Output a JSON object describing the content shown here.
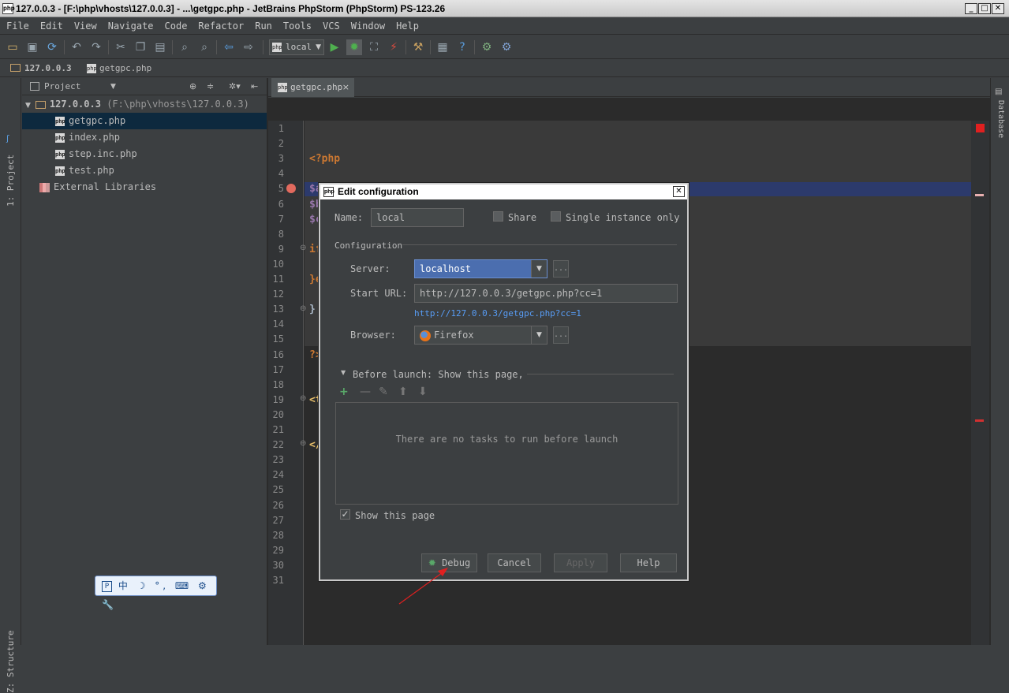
{
  "window": {
    "title": "127.0.0.3 - [F:\\php\\vhosts\\127.0.0.3] - ...\\getgpc.php - JetBrains PhpStorm (PhpStorm) PS-123.26",
    "app_icon_label": "php",
    "minimize": "_",
    "maximize": "□",
    "close": "✕"
  },
  "menu": [
    "File",
    "Edit",
    "View",
    "Navigate",
    "Code",
    "Refactor",
    "Run",
    "Tools",
    "VCS",
    "Window",
    "Help"
  ],
  "toolbar": {
    "run_config": "local",
    "icons": [
      "open-icon",
      "save-icon",
      "sync-icon",
      "undo-icon",
      "redo-icon",
      "cut-icon",
      "copy-icon",
      "paste-icon",
      "find-icon",
      "replace-icon",
      "back-icon",
      "forward-icon",
      "run-icon",
      "debug-icon",
      "coverage-icon",
      "stop-icon",
      "settings-icon",
      "structure-icon",
      "help-icon",
      "plugin-icon",
      "plugin2-icon"
    ]
  },
  "breadcrumb": {
    "project": "127.0.0.3",
    "file": "getgpc.php"
  },
  "left_strip": {
    "project_tab": "1: Project",
    "structure_tab": "Z: Structure"
  },
  "project_panel": {
    "title": "Project",
    "root_name": "127.0.0.3",
    "root_path": "(F:\\php\\vhosts\\127.0.0.3)",
    "files": [
      "getgpc.php",
      "index.php",
      "step.inc.php",
      "test.php"
    ],
    "external": "External Libraries"
  },
  "ime_bar": {
    "text": "中 ☽ °, ⌨ ⚙ 🔧"
  },
  "editor": {
    "tab": "getgpc.php",
    "tab_close": "×",
    "line_count": 31,
    "visible_code": [
      {
        "line": 3,
        "text": "<?php",
        "color": "#cc7832"
      },
      {
        "line": 5,
        "text": "$a",
        "color": "#9876aa"
      },
      {
        "line": 6,
        "text": "$b",
        "color": "#9876aa"
      },
      {
        "line": 7,
        "text": "$c",
        "color": "#9876aa"
      },
      {
        "line": 9,
        "text": "if",
        "color": "#cc7832"
      },
      {
        "line": 11,
        "text": "}e",
        "color": "#cc7832"
      },
      {
        "line": 13,
        "text": "}",
        "color": "#a9b7c6"
      },
      {
        "line": 16,
        "text": "?>",
        "color": "#cc7832"
      },
      {
        "line": 19,
        "text": "<t",
        "color": "#e8bf6a"
      },
      {
        "line": 22,
        "text": "</",
        "color": "#e8bf6a"
      }
    ]
  },
  "right_strip": {
    "database_tab": "Database"
  },
  "dialog": {
    "title": "Edit configuration",
    "name_label": "Name:",
    "name_value": "local",
    "share_label": "Share",
    "single_instance_label": "Single instance only",
    "configuration_label": "Configuration",
    "server_label": "Server:",
    "server_value": "localhost",
    "start_url_label": "Start URL:",
    "start_url_value": "http://127.0.0.3/getgpc.php?cc=1",
    "start_url_link": "http://127.0.0.3/getgpc.php?cc=1",
    "browser_label": "Browser:",
    "browser_value": "Firefox",
    "before_launch_label": "Before launch: Show this page,",
    "no_tasks_text": "There are no tasks to run before launch",
    "show_page_label": "Show this page",
    "show_page_checked": true,
    "buttons": {
      "debug": "Debug",
      "cancel": "Cancel",
      "apply": "Apply",
      "help": "Help"
    },
    "ellipsis": "..."
  },
  "colors": {
    "background": "#3c3f41",
    "editor_bg": "#2b2b2b",
    "selection": "#4b6eaf",
    "link": "#589df6",
    "breakpoint": "#e26a5e",
    "add_green": "#59a869",
    "annotation_arrow": "#e02020"
  }
}
